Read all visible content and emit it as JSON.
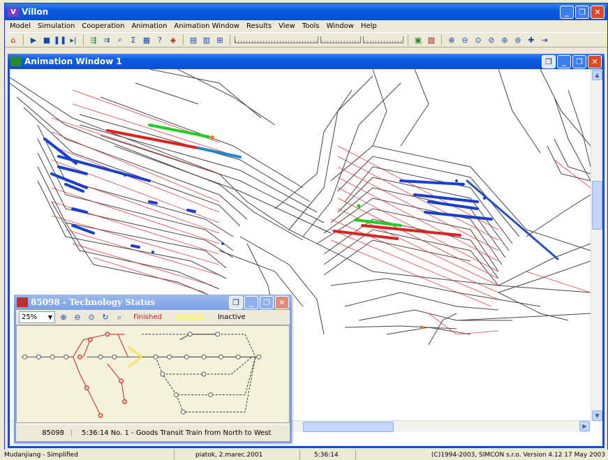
{
  "app": {
    "title": "Villon",
    "logo_letter": "V"
  },
  "menu": [
    "Model",
    "Simulation",
    "Cooperation",
    "Animation",
    "Animation Window",
    "Results",
    "View",
    "Tools",
    "Window",
    "Help"
  ],
  "toolbar": {
    "icons": [
      "home-icon",
      "play-icon",
      "stop-icon",
      "pause-icon",
      "step-icon",
      "train-icon",
      "trains-icon",
      "zoom-area-icon",
      "sum-icon",
      "grid-icon",
      "help-arrow-icon",
      "compass-icon",
      "map-icon",
      "layers-icon",
      "tree-icon",
      "book-icon",
      "chart-icon",
      "zoom-in-icon",
      "zoom-out-icon",
      "zoom-fit-icon",
      "zoom-prev-icon",
      "zoom-next-icon",
      "pan-icon",
      "arrow-icon"
    ]
  },
  "animation_window": {
    "title": "Animation Window 1"
  },
  "tech_window": {
    "title": "85098 - Technology Status",
    "zoom_value": "25%",
    "legend_finished": "Finished",
    "legend_inactive": "Inactive",
    "status_id": "85098",
    "status_text": "5:36:14 No. 1 - Goods Transit Train from North to West"
  },
  "statusbar": {
    "model_name": "Mudanjiang - Simplified",
    "date": "piatok, 2.marec.2001",
    "time": "5:36:14",
    "copyright": "(C)1994-2003, SIMCON s.r.o.  Version 4.12  17 May 2003"
  },
  "colors": {
    "track": "#444444",
    "occupied": "#e02020",
    "train_blue": "#1a3fd0",
    "train_green": "#22cc22",
    "train_cyan": "#2288cc"
  }
}
